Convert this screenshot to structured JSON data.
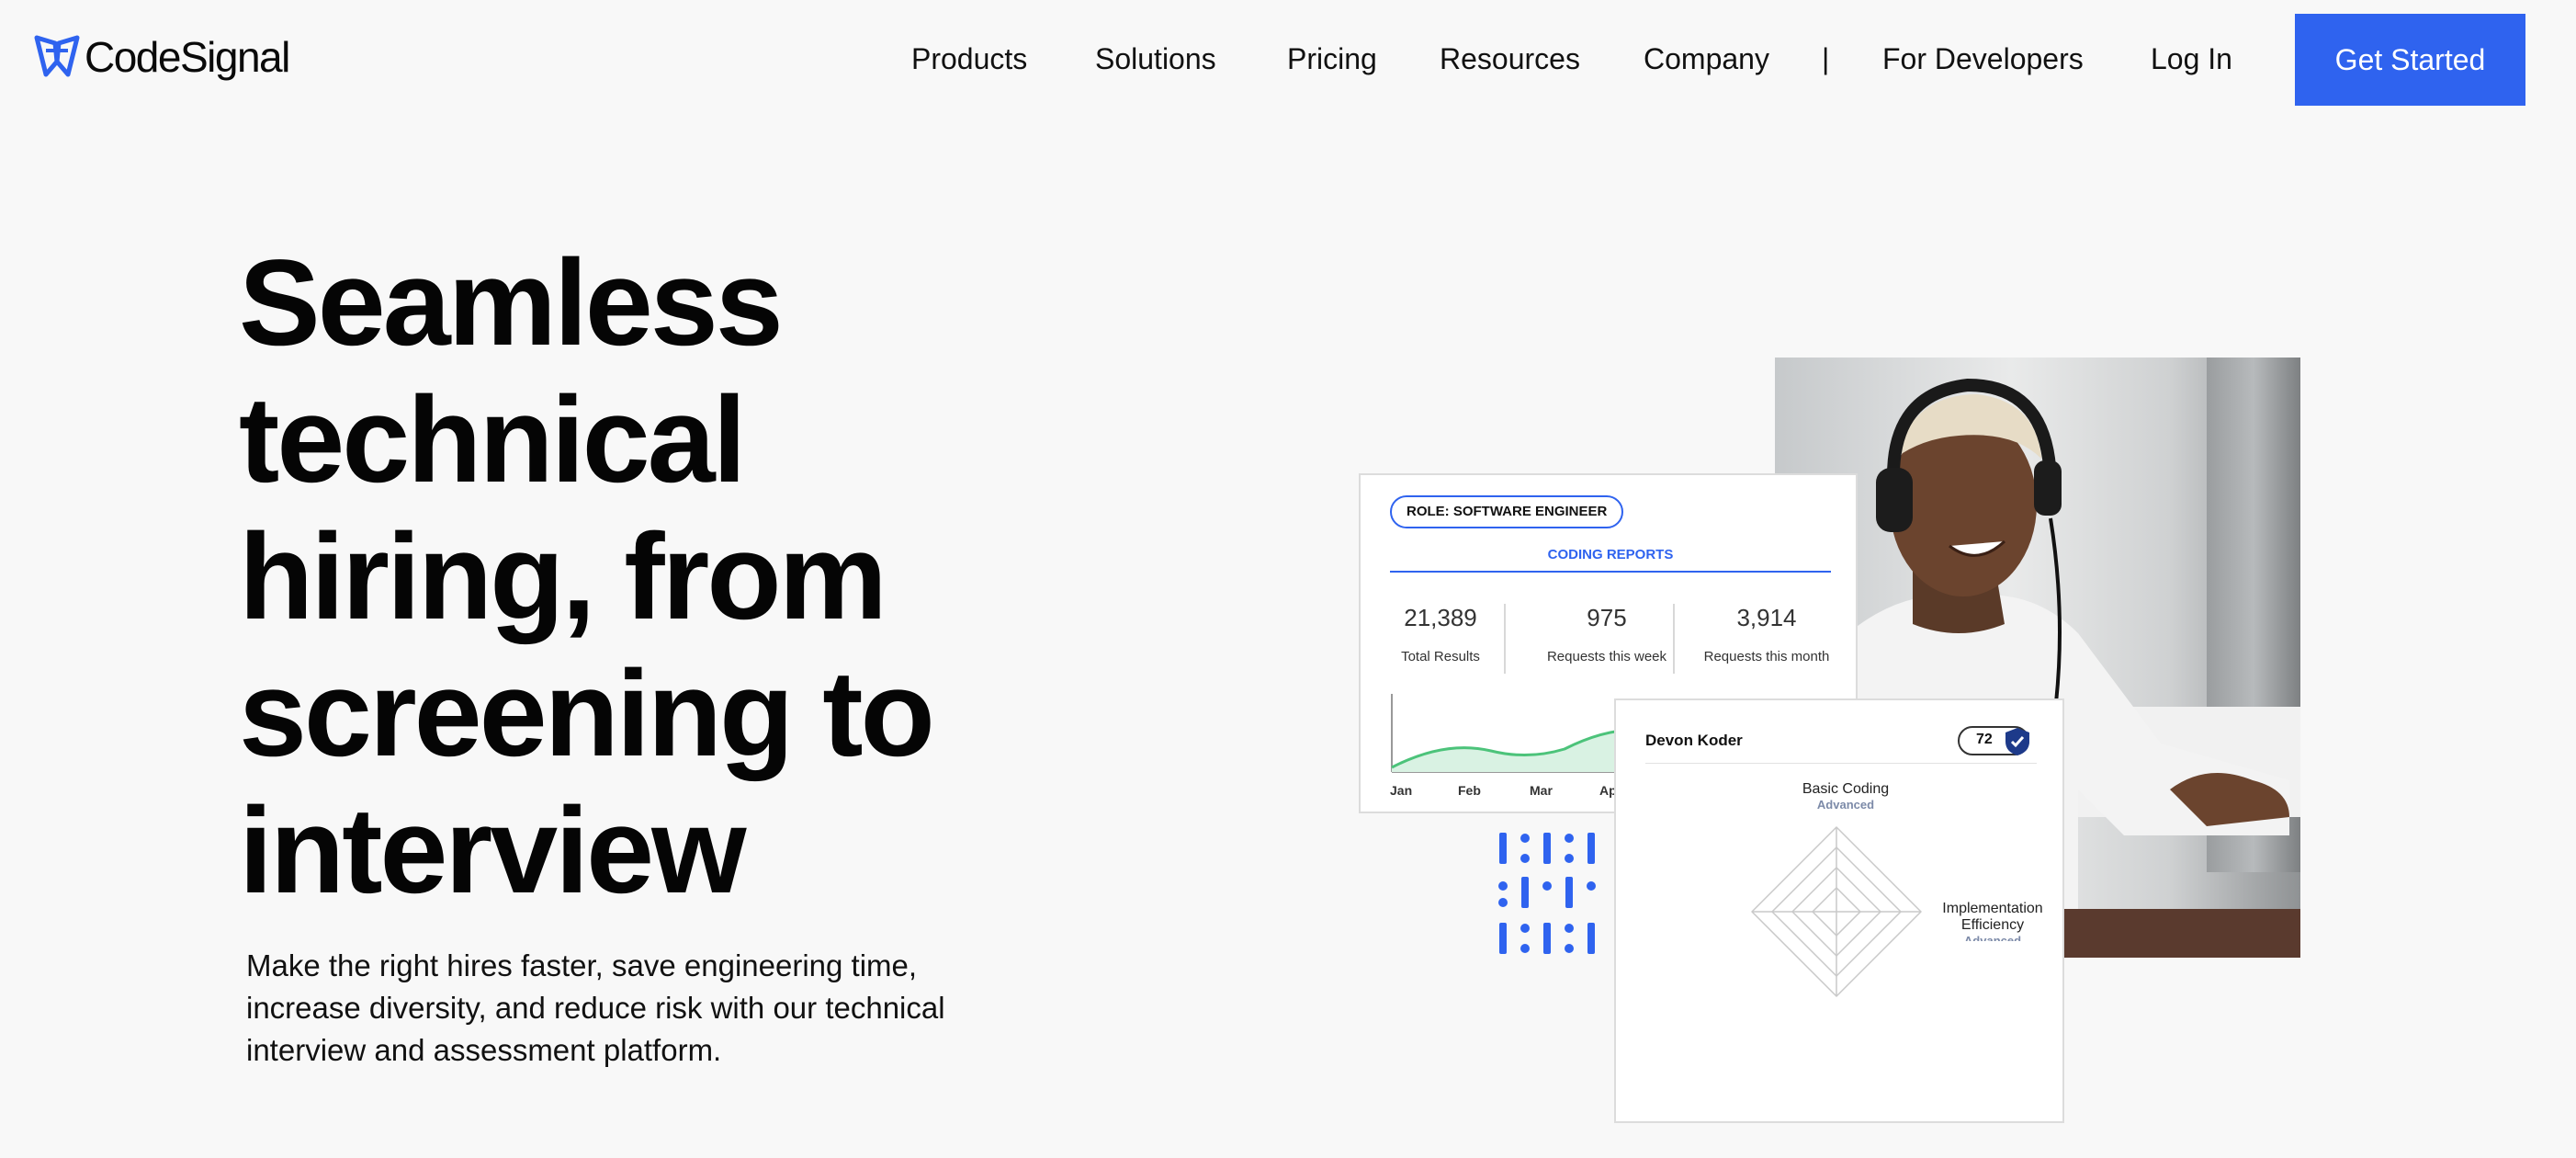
{
  "brand": {
    "name": "CodeSignal",
    "accent": "#2f63ef"
  },
  "nav": {
    "items": [
      "Products",
      "Solutions",
      "Pricing",
      "Resources",
      "Company"
    ],
    "separator": "|",
    "developers": "For Developers",
    "login": "Log In",
    "cta": "Get Started"
  },
  "hero": {
    "headline": "Seamless technical hiring, from screening to interview",
    "subhead": "Make the right hires faster, save engineering time, increase diversity, and reduce risk with our technical interview and assessment platform."
  },
  "report_card": {
    "role": "ROLE: SOFTWARE ENGINEER",
    "title": "CODING REPORTS",
    "stats": [
      {
        "value": "21,389",
        "label": "Total Results"
      },
      {
        "value": "975",
        "label": "Requests this week"
      },
      {
        "value": "3,914",
        "label": "Requests this month"
      }
    ],
    "months": [
      "Jan",
      "Feb",
      "Mar",
      "Ap"
    ]
  },
  "profile_card": {
    "name": "Devon Koder",
    "score": "72",
    "skills": [
      {
        "name": "Basic Coding",
        "level": "Advanced"
      },
      {
        "name": "Implementation Efficiency",
        "level": "Advanced"
      }
    ]
  },
  "icons": {
    "logo": "codesignal-logo-icon",
    "shield": "shield-check-icon"
  }
}
